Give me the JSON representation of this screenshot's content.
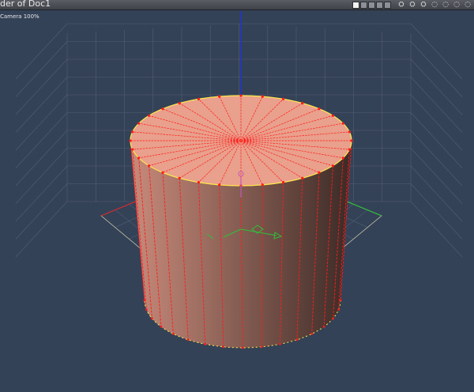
{
  "window": {
    "title": "der of Doc1"
  },
  "toolbar": {
    "layout_buttons": [
      "single-view",
      "split-view",
      "quad-view",
      "four-up-view",
      "three-up-view"
    ],
    "icons": [
      {
        "name": "tool-icon-1",
        "glyph": "⛭"
      },
      {
        "name": "tool-icon-2",
        "glyph": "⛭"
      },
      {
        "name": "tool-icon-3",
        "glyph": "⛭"
      },
      {
        "name": "tool-icon-4",
        "glyph": "◌"
      },
      {
        "name": "tool-icon-5",
        "glyph": "◌"
      },
      {
        "name": "tool-icon-6",
        "glyph": "◌"
      },
      {
        "name": "tool-icon-7",
        "glyph": "◌"
      }
    ]
  },
  "viewport": {
    "camera_label": "Camera 100%",
    "background_color": "#344257",
    "grid_color": "#5b677b",
    "axis_x_color": "#d0262c",
    "axis_y_color": "#2fbf3a",
    "axis_z_color": "#2233d8",
    "mesh": {
      "type": "cylinder",
      "segments": 32,
      "fill_top": "#e9a08c",
      "fill_side_light": "#c78a7a",
      "fill_side_dark": "#3b2a26",
      "edge_color": "#ff1c1c",
      "highlight_edge_color": "#ffe84a"
    }
  }
}
